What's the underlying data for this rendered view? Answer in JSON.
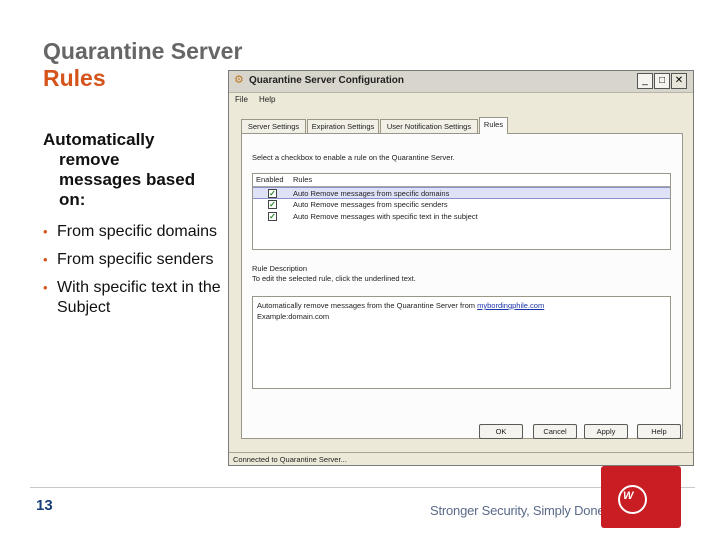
{
  "slide": {
    "title_line1": "Quarantine Server",
    "title_line2": "Rules",
    "lead_line1": "Automatically",
    "lead_line2": "remove",
    "lead_line3": "messages based",
    "lead_line4": "on:",
    "bullets": [
      "From specific domains",
      "From specific senders",
      "With specific text in the Subject"
    ],
    "page_number": "13",
    "tagline": "Stronger Security, Simply Done",
    "tagline_tm": "TM",
    "accent_color": "#d4541b"
  },
  "window": {
    "title": "Quarantine Server Configuration",
    "menu": [
      "File",
      "Help"
    ],
    "tabs": [
      "Server Settings",
      "Expiration Settings",
      "User Notification Settings",
      "Rules"
    ],
    "active_tab": "Rules",
    "instruction": "Select a checkbox to enable a rule on the Quarantine Server.",
    "columns": [
      "Enabled",
      "Rules"
    ],
    "rules": [
      {
        "enabled": true,
        "label": "Auto Remove messages from specific domains",
        "selected": true
      },
      {
        "enabled": true,
        "label": "Auto Remove messages from specific senders",
        "selected": false
      },
      {
        "enabled": true,
        "label": "Auto Remove messages with specific text in the subject",
        "selected": false
      }
    ],
    "description_label": "Rule Description",
    "description_hint": "To edit the selected rule, click the underlined text.",
    "description_text": "Automatically remove messages from the Quarantine Server from",
    "description_link": "mybordingphile.com",
    "description_line2": "Example:domain.com",
    "buttons": [
      "OK",
      "Cancel",
      "Apply",
      "Help"
    ],
    "status": "Connected to Quarantine Server..."
  }
}
